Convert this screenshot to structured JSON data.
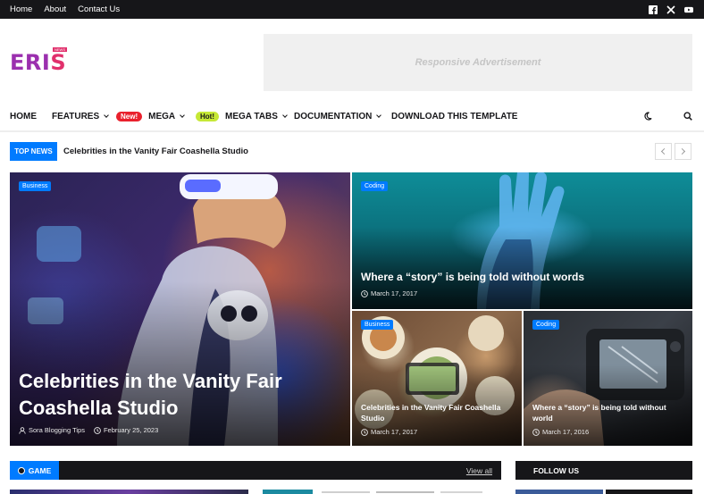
{
  "top_nav": [
    "Home",
    "About",
    "Contact Us"
  ],
  "social": [
    "facebook-icon",
    "x-twitter-icon",
    "youtube-icon"
  ],
  "brand": {
    "name_main": "ERI",
    "name_accent": "S",
    "badge": "NEWS",
    "primary": "#9b2fae",
    "accent": "#e1306c"
  },
  "ad": {
    "text": "Responsive Advertisement"
  },
  "main_nav": {
    "home": "HOME",
    "features": "FEATURES",
    "mega_tag": "New!",
    "mega": "MEGA",
    "mega_tabs_tag": "Hot!",
    "mega_tabs": "MEGA TABS",
    "documentation": "DOCUMENTATION",
    "download": "DOWNLOAD THIS TEMPLATE"
  },
  "ticker": {
    "label": "TOP NEWS",
    "headline": "Celebrities in the Vanity Fair Coashella Studio"
  },
  "featured": [
    {
      "category": "Business",
      "title": "Celebrities in the Vanity Fair Coashella Studio",
      "author": "Sora Blogging Tips",
      "date": "February 25, 2023"
    },
    {
      "category": "Coding",
      "title": "Where a “story” is being told without words",
      "date": "March 17, 2017"
    },
    {
      "category": "Business",
      "title": "Celebrities in the Vanity Fair Coashella Studio",
      "date": "March 17, 2017"
    },
    {
      "category": "Coding",
      "title": "Where a “story” is being told without world",
      "date": "March 17, 2016"
    }
  ],
  "sections": {
    "game": "GAME",
    "view_all": "View all",
    "follow": "FOLLOW US"
  },
  "colors": {
    "blue": "#007bff",
    "dark": "#161619",
    "new_tag": "#e9212d",
    "hot_tag": "#c6e836"
  }
}
